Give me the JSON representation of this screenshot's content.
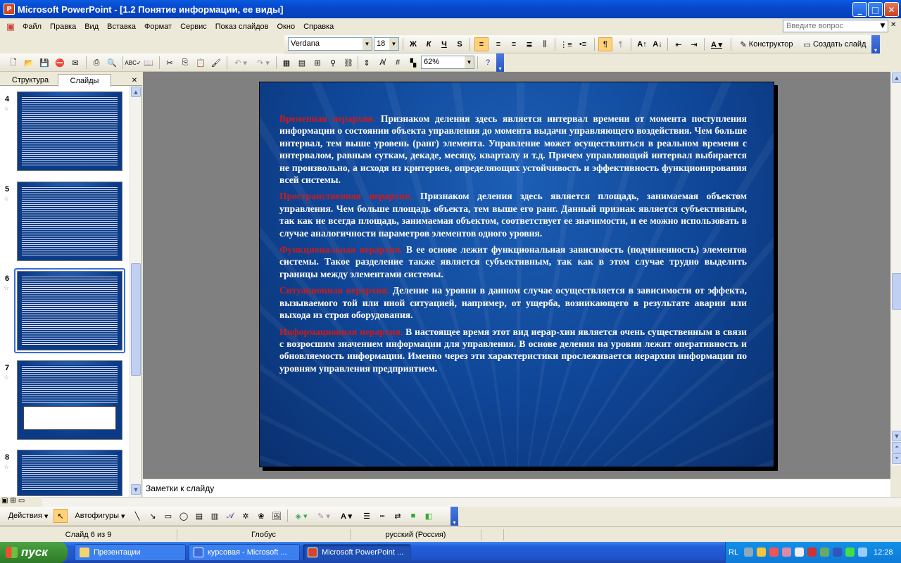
{
  "window": {
    "title": "Microsoft PowerPoint - [1.2 Понятие информации, ее виды]"
  },
  "menu": {
    "items": [
      "Файл",
      "Правка",
      "Вид",
      "Вставка",
      "Формат",
      "Сервис",
      "Показ слайдов",
      "Окно",
      "Справка"
    ],
    "ask_placeholder": "Введите вопрос"
  },
  "format_toolbar": {
    "font": "Verdana",
    "size": "18",
    "designer": "Конструктор",
    "new_slide": "Создать слайд"
  },
  "standard_toolbar": {
    "zoom": "62%"
  },
  "panel_tabs": {
    "outline": "Структура",
    "slides": "Слайды"
  },
  "thumbnails": [
    {
      "number": "4"
    },
    {
      "number": "5"
    },
    {
      "number": "6",
      "selected": true
    },
    {
      "number": "7"
    },
    {
      "number": "8"
    }
  ],
  "slide": {
    "paragraphs": [
      {
        "heading": "Временная иерархия.",
        "body": " Признаком деления здесь является интервал времени от момента поступления информации о состоянии объекта управления до момента выдачи управляющего воздействия. Чем больше интервал, тем выше уровень (ранг) элемента. Управление может осуществляться в реальном времени с интервалом, равным суткам, декаде, месяцу, кварталу и т.д. Причем управляющий интервал выбирается не произвольно, а исходя из критериев, определяющих устойчивость и эффективность функционирования всей системы."
      },
      {
        "heading": "Пространственная иерархия.",
        "body": " Признаком деления здесь является площадь, занимаемая объектом управления. Чем больше площадь объекта, тем выше его ранг. Данный признак является субъективным, так как не всегда площадь, занимаемая объектом, соответствует ее значимости, и ее можно использовать в случае аналогичности параметров элементов одного уровня."
      },
      {
        "heading": "Функциональная иерархия.",
        "body": " В ее основе лежит функциональная зависимость (подчиненность) элементов системы. Такое разделение также является субъективным, так как в этом случае трудно выделить границы между элементами системы."
      },
      {
        "heading": "Ситуационная иерархия.",
        "body": " Деление на уровни в данном случае осуществляется в зависимости от эффекта, вызываемого той или иной ситуацией, например, от ущерба, возникающего в результате аварии или выхода из строя оборудования."
      },
      {
        "heading": "Информационная иерархия.",
        "body": " В настоящее время этот вид иерар-хии является очень существенным в связи с возросшим значением информации для управления. В основе деления на уровни лежит оперативность и обновляемость информации. Именно через эти характеристики прослеживается иерархия информации по уровням управления предприятием."
      }
    ]
  },
  "notes": {
    "placeholder": "Заметки к слайду"
  },
  "draw_toolbar": {
    "actions": "Действия",
    "autoshapes": "Автофигуры"
  },
  "status": {
    "slide": "Слайд 6 из 9",
    "design": "Глобус",
    "language": "русский (Россия)"
  },
  "taskbar": {
    "start": "пуск",
    "tasks": [
      "Презентации",
      "курсовая - Microsoft ...",
      "Microsoft PowerPoint ..."
    ],
    "lang": "RL",
    "clock": "12:28"
  },
  "colors": {
    "titlebar": "#0746c9",
    "slide_bg": "#0f4596",
    "heading_red": "#d01a1a",
    "taskbar": "#245edb",
    "start_green": "#3a8f33"
  }
}
